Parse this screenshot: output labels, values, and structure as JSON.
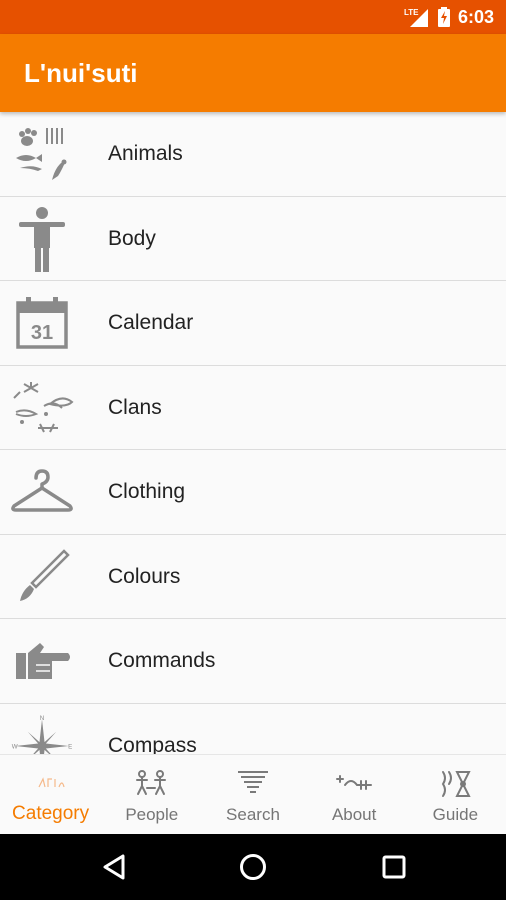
{
  "status_bar": {
    "network": "LTE",
    "time": "6:03"
  },
  "app_bar": {
    "title": "L'nui'suti"
  },
  "categories": [
    {
      "label": "Animals",
      "icon": "animals-icon"
    },
    {
      "label": "Body",
      "icon": "body-icon"
    },
    {
      "label": "Calendar",
      "icon": "calendar-icon",
      "icon_text": "31"
    },
    {
      "label": "Clans",
      "icon": "clans-icon"
    },
    {
      "label": "Clothing",
      "icon": "hanger-icon"
    },
    {
      "label": "Colours",
      "icon": "paintbrush-icon"
    },
    {
      "label": "Commands",
      "icon": "pointing-hand-icon"
    },
    {
      "label": "Compass",
      "icon": "compass-icon",
      "icon_letters": [
        "N",
        "W",
        "E"
      ]
    }
  ],
  "bottom_nav": [
    {
      "label": "Category",
      "active": true
    },
    {
      "label": "People",
      "active": false
    },
    {
      "label": "Search",
      "active": false
    },
    {
      "label": "About",
      "active": false
    },
    {
      "label": "Guide",
      "active": false
    }
  ],
  "colors": {
    "status_bar": "#e65100",
    "app_bar": "#f57c00",
    "accent": "#f57c00",
    "icon_gray": "#8a8a8a"
  }
}
